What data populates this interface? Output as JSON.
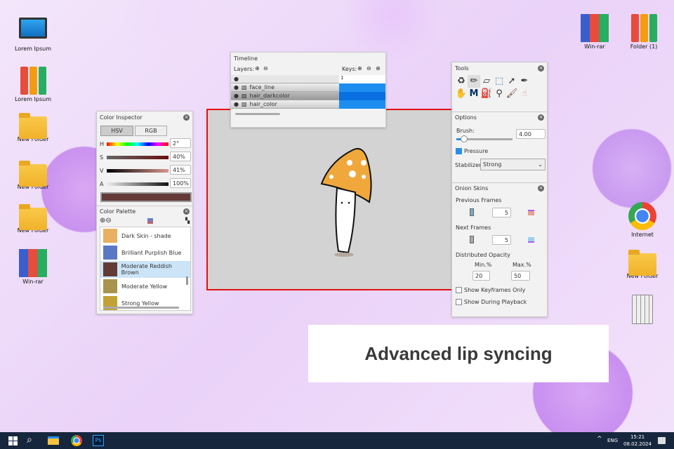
{
  "desktop": {
    "left": [
      "Lorem Ipsum",
      "Lorem Ipsum",
      "New Folder",
      "New Folder",
      "New Folder",
      "Win-rar"
    ],
    "right": [
      "Win-rar",
      "Folder (1)",
      "Internet",
      "New Folder"
    ]
  },
  "timeline": {
    "title": "Timeline",
    "layers_label": "Layers:",
    "keys_label": "Keys:",
    "frame": "1",
    "layers": [
      "face_line",
      "hair_darkcolor",
      "hair_color"
    ]
  },
  "color_inspector": {
    "title": "Color Inspector",
    "tabs": [
      "HSV",
      "RGB"
    ],
    "channels": [
      {
        "label": "H",
        "value": "2°"
      },
      {
        "label": "S",
        "value": "40%"
      },
      {
        "label": "V",
        "value": "41%"
      },
      {
        "label": "A",
        "value": "100%"
      }
    ],
    "current_color": "#633a36"
  },
  "color_palette": {
    "title": "Color Palette",
    "items": [
      {
        "name": "Dark Skin - shade",
        "color": "#e8b060"
      },
      {
        "name": "Brilliant Purplish Blue",
        "color": "#5a78c4"
      },
      {
        "name": "Moderate Reddish Brown",
        "color": "#633a36",
        "selected": true
      },
      {
        "name": "Moderate Yellow",
        "color": "#a8944e"
      },
      {
        "name": "Strong Yellow",
        "color": "#c2a234"
      }
    ]
  },
  "tools": {
    "title": "Tools"
  },
  "options": {
    "title": "Options",
    "brush_label": "Brush:",
    "brush_value": "4.00",
    "brush_fraction": 0.1,
    "pressure_label": "Pressure",
    "stabilizer_label": "Stabilizer",
    "stabilizer_value": "Strong"
  },
  "onion": {
    "title": "Onion Skins",
    "prev_label": "Previous Frames",
    "prev_value": "5",
    "next_label": "Next Frames",
    "next_value": "5",
    "dist_label": "Distributed Opacity",
    "min_label": "Min.%",
    "min_value": "20",
    "max_label": "Max.%",
    "max_value": "50",
    "keyframes_only": "Show Keyframes Only",
    "during_playback": "Show During Playback"
  },
  "banner": "Advanced lip syncing",
  "taskbar": {
    "lang": "ENG",
    "time": "15:21",
    "date": "08.02.2024",
    "ps": "Ps"
  }
}
